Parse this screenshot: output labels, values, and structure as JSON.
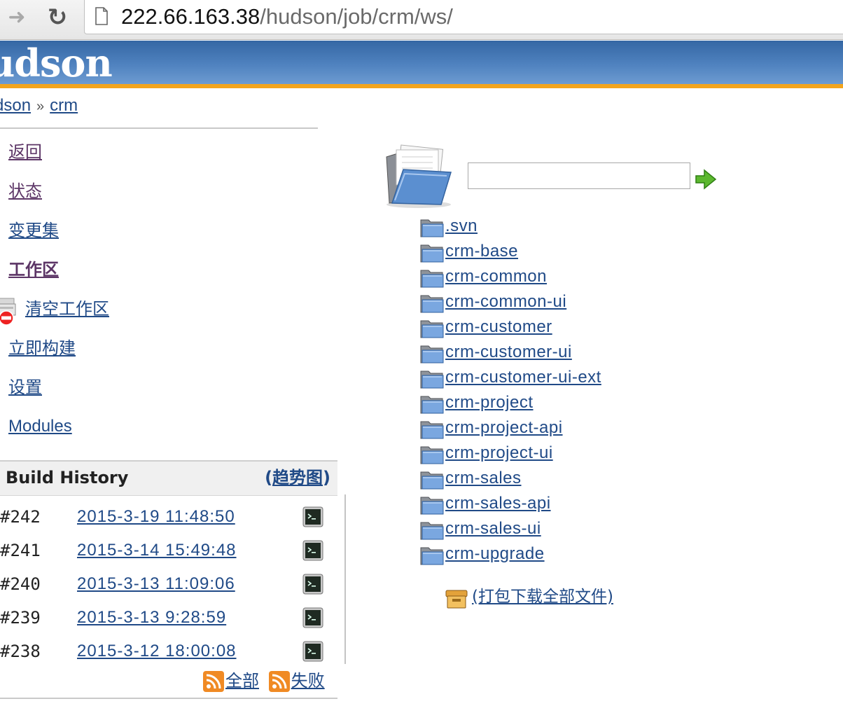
{
  "browser": {
    "url_host": "222.66.163.38",
    "url_path": "/hudson/job/crm/ws/"
  },
  "header": {
    "logo_text": "udson"
  },
  "breadcrumb": {
    "items": [
      "dson",
      "crm"
    ],
    "separator": "»"
  },
  "tasks": [
    {
      "label": "返回",
      "state": "visited"
    },
    {
      "label": "状态",
      "state": "visited"
    },
    {
      "label": "变更集",
      "state": "normal"
    },
    {
      "label": "工作区",
      "state": "current"
    },
    {
      "label": "清空工作区",
      "state": "normal",
      "icon": "wipe-workspace-icon"
    },
    {
      "label": "立即构建",
      "state": "normal"
    },
    {
      "label": "设置",
      "state": "normal"
    },
    {
      "label": "Modules",
      "state": "normal"
    }
  ],
  "build_history": {
    "title": "Build History",
    "trend_open": "(",
    "trend_label": "趋势图",
    "trend_close": ")",
    "builds": [
      {
        "number": "#242",
        "date": "2015-3-19 11:48:50"
      },
      {
        "number": "#241",
        "date": "2015-3-14 15:49:48"
      },
      {
        "number": "#240",
        "date": "2015-3-13 11:09:06"
      },
      {
        "number": "#239",
        "date": "2015-3-13 9:28:59"
      },
      {
        "number": "#238",
        "date": "2015-3-12 18:00:08"
      }
    ],
    "feed_all": "全部",
    "feed_failed": "失败"
  },
  "workspace": {
    "search_value": "",
    "directories": [
      ".svn",
      "crm-base",
      "crm-common",
      "crm-common-ui",
      "crm-customer",
      "crm-customer-ui",
      "crm-customer-ui-ext",
      "crm-project",
      "crm-project-api",
      "crm-project-ui",
      "crm-sales",
      "crm-sales-api",
      "crm-sales-ui",
      "crm-upgrade"
    ],
    "zip_label": "(打包下载全部文件)"
  },
  "colors": {
    "header_blue": "#3567a4",
    "header_stripe": "#f3a51d",
    "link": "#204a87",
    "visited": "#5c3566"
  }
}
